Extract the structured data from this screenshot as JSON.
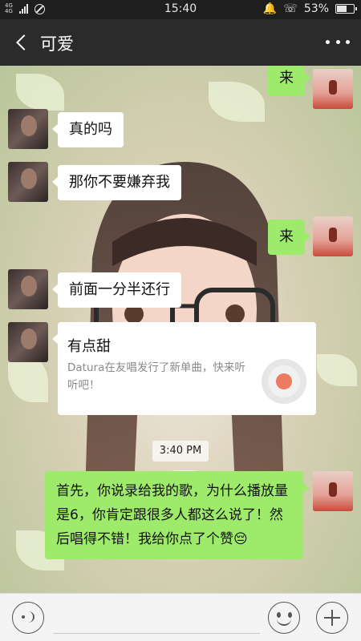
{
  "status_bar": {
    "network": "4G 4G",
    "time": "15:40",
    "battery": "53%",
    "battery_level": 0.53
  },
  "header": {
    "title": "可爱"
  },
  "messages": [
    {
      "side": "out",
      "text": "来"
    },
    {
      "side": "in",
      "text": "真的吗"
    },
    {
      "side": "in",
      "text": "那你不要嫌弃我"
    },
    {
      "side": "out",
      "text": "来"
    },
    {
      "side": "in",
      "text": "前面一分半还行"
    }
  ],
  "share_card": {
    "title": "有点甜",
    "description": "Datura在友唱发行了新单曲，快来听听吧！"
  },
  "timestamp": "3:40 PM",
  "last_message": {
    "side": "out",
    "text": "首先，你说录给我的歌，为什么播放量是6，你肯定跟很多人都这么说了！然后唱得不错！我给你点了个赞😔"
  },
  "colors": {
    "outgoing_bubble": "#9eea6a",
    "incoming_bubble": "#ffffff",
    "header_bg": "#2b2b2b"
  }
}
